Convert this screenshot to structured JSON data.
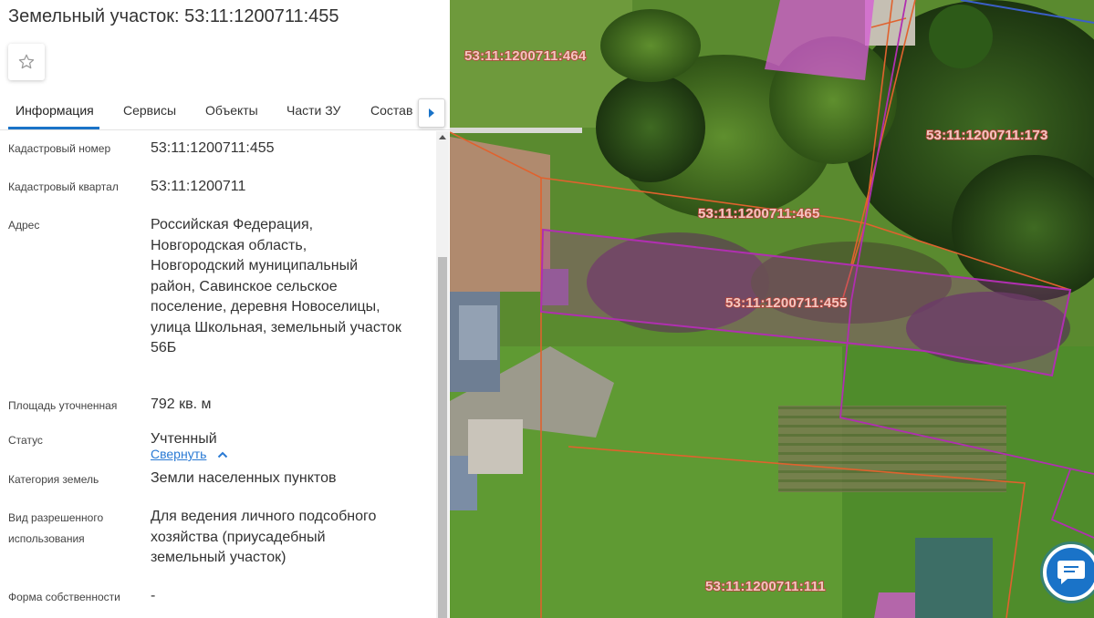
{
  "title": "Земельный участок: 53:11:1200711:455",
  "tabs": [
    {
      "label": "Информация"
    },
    {
      "label": "Сервисы"
    },
    {
      "label": "Объекты"
    },
    {
      "label": "Части ЗУ"
    },
    {
      "label": "Состав"
    }
  ],
  "info": {
    "cad_number": {
      "label": "Кадастровый номер",
      "value": "53:11:1200711:455"
    },
    "cad_quarter": {
      "label": "Кадастровый квартал",
      "value": "53:11:1200711"
    },
    "address": {
      "label": "Адрес",
      "lines": [
        "Российская Федерация,",
        "Новгородская область,",
        "Новгородский муниципальный",
        "район, Савинское сельское",
        "поселение, деревня Новоселицы,",
        "улица Школьная, земельный участок",
        "56Б"
      ],
      "collapse_label": "Свернуть"
    },
    "area": {
      "label": "Площадь уточненная",
      "value": "792 кв. м"
    },
    "status": {
      "label": "Статус",
      "value": "Учтенный"
    },
    "category": {
      "label": "Категория земель",
      "value": "Земли населенных пунктов"
    },
    "usage": {
      "label_lines": [
        "Вид разрешенного",
        "использования"
      ],
      "value_lines": [
        "Для ведения личного подсобного",
        "хозяйства (приусадебный",
        "земельный участок)"
      ]
    },
    "ownership": {
      "label": "Форма собственности",
      "value": "-"
    }
  },
  "map": {
    "plot_labels": [
      "53:11:1200711:464",
      "53:11:1200711:173",
      "53:11:1200711:465",
      "53:11:1200711:455",
      "53:11:1200711:111"
    ],
    "colors": {
      "selected_outline": "#b02fb0",
      "neighbor_outline": "#e0622e",
      "accent": "#1a73c8"
    }
  },
  "icons": {
    "favorite": "star-icon",
    "tabs_next": "chevron-right-icon",
    "collapse": "chevron-up-icon",
    "chat": "chat-icon"
  }
}
